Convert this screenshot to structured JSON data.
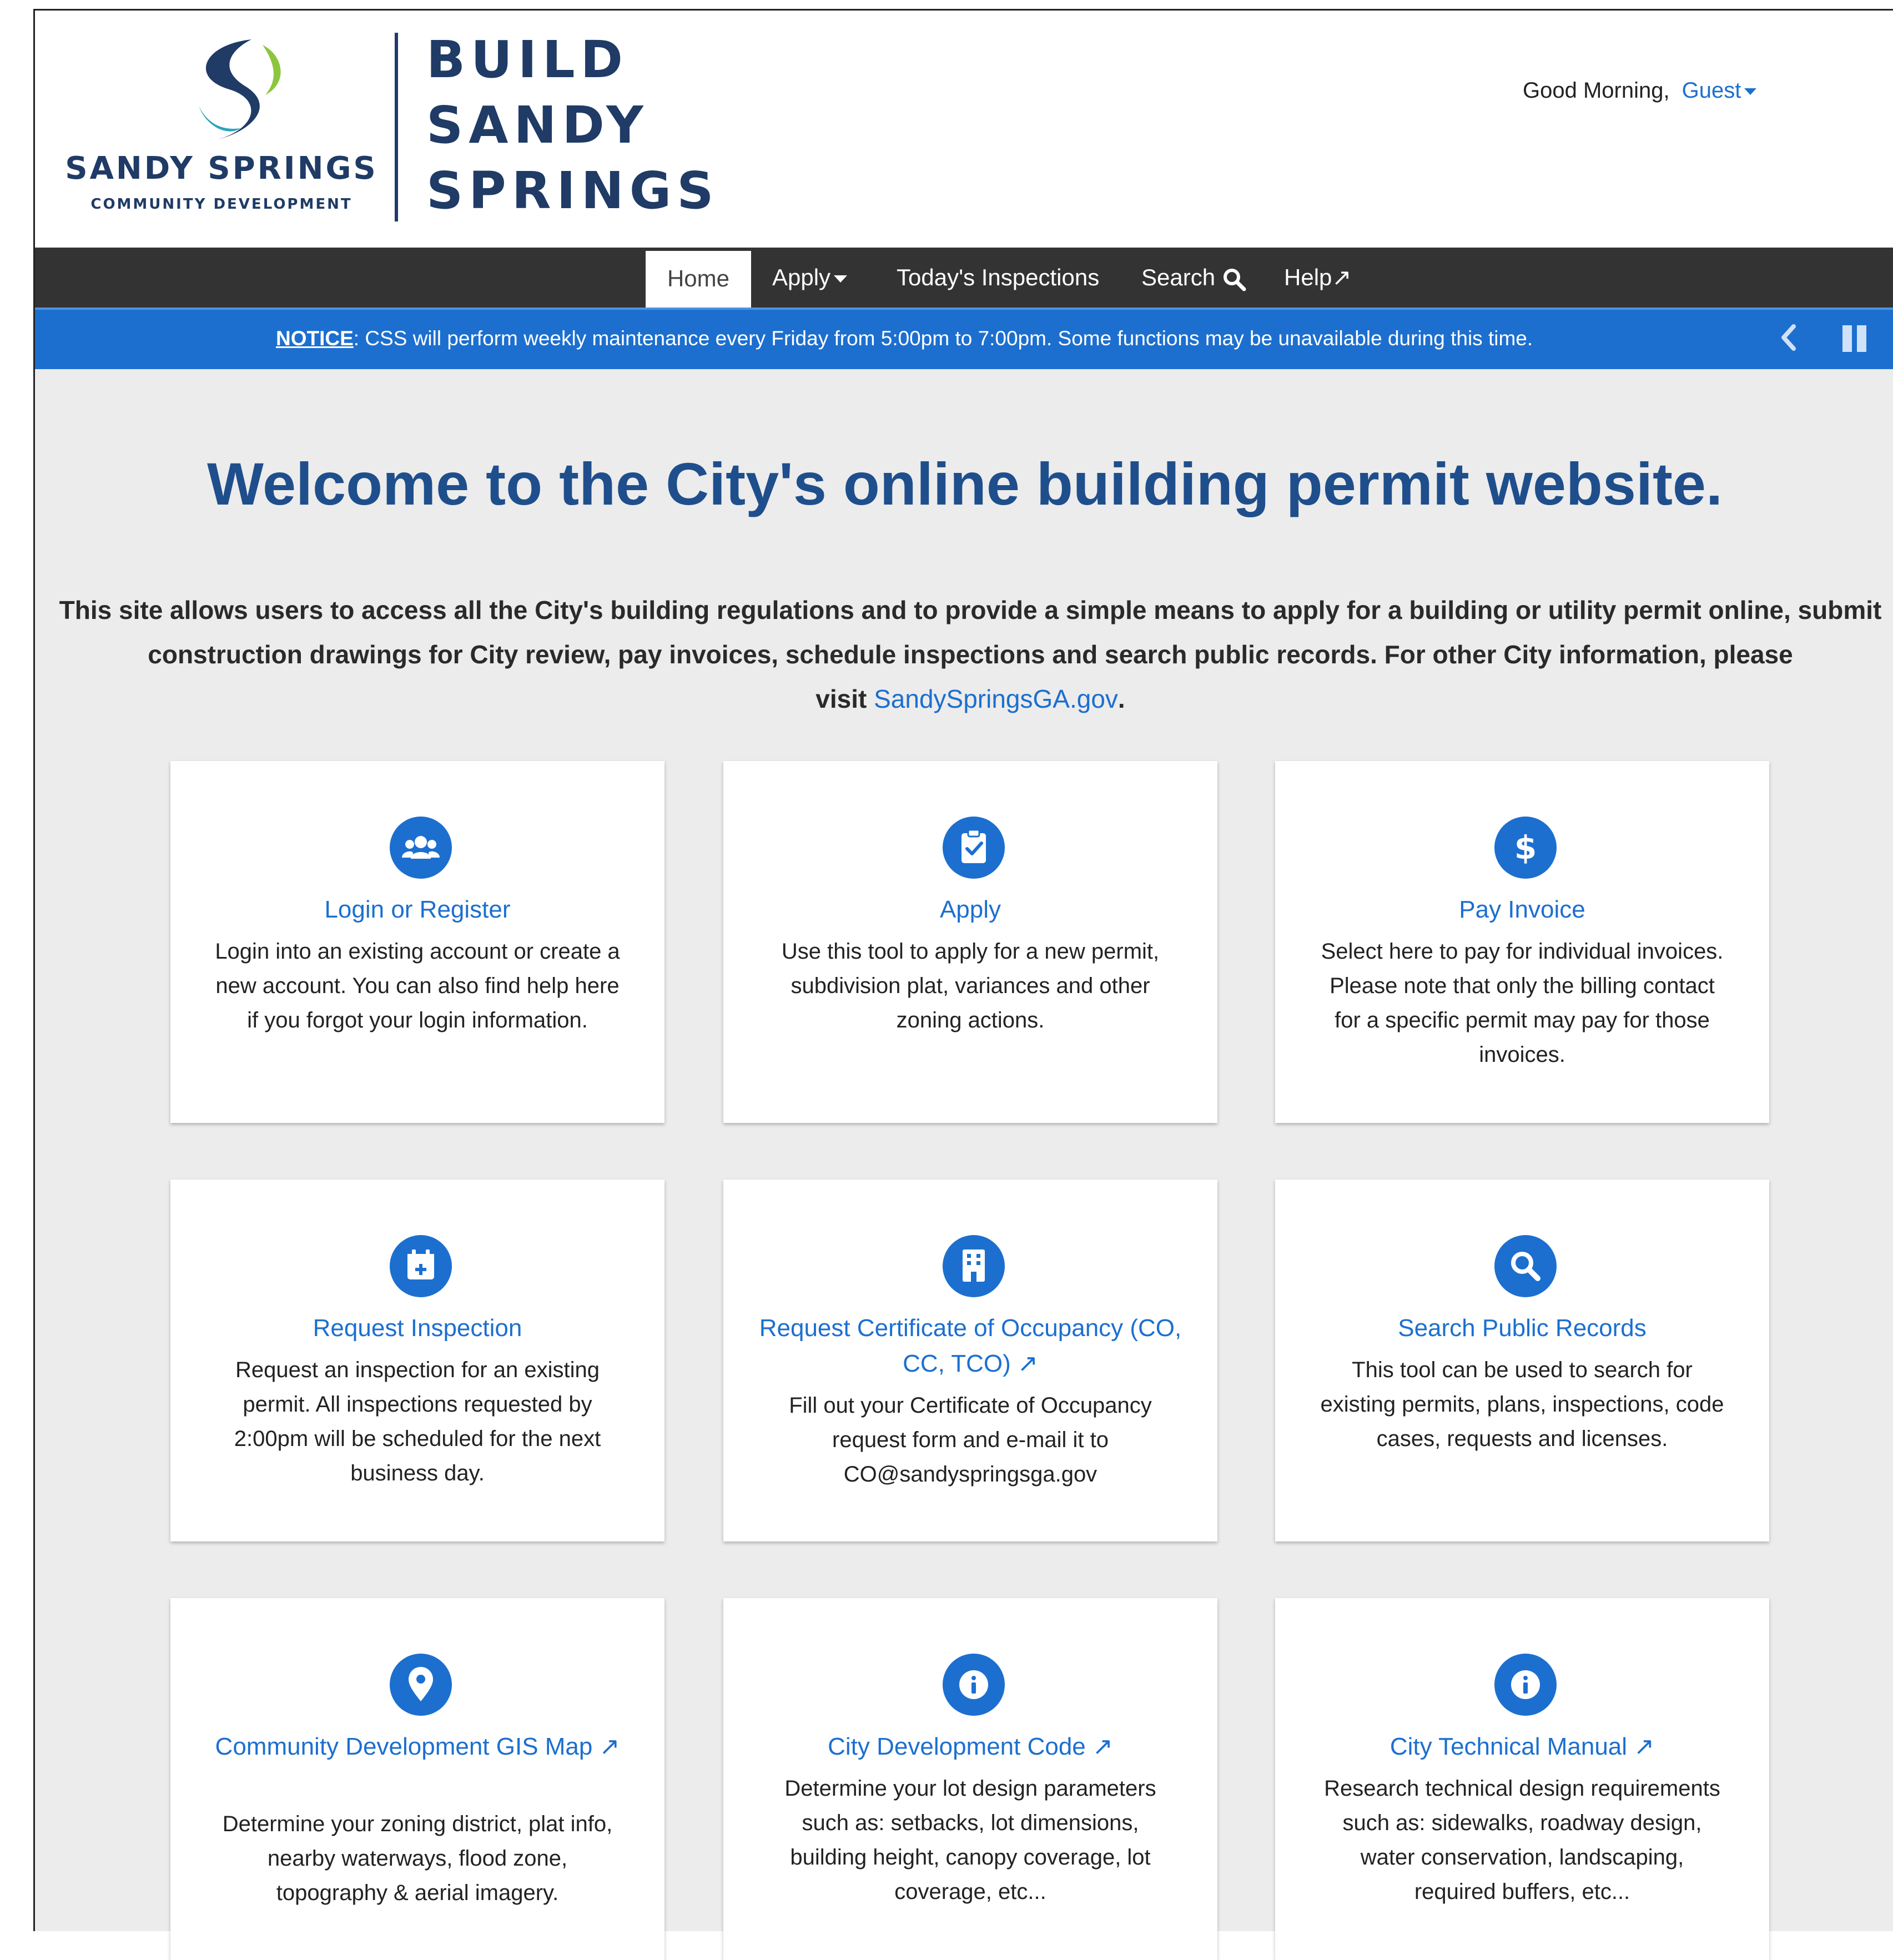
{
  "header": {
    "brand_name": "SANDY SPRINGS",
    "brand_sub": "COMMUNITY DEVELOPMENT",
    "title_line1": "BUILD",
    "title_line2": "SANDY",
    "title_line3": "SPRINGS",
    "greeting": "Good Morning,",
    "user": "Guest"
  },
  "nav": {
    "home": "Home",
    "apply": "Apply",
    "inspections": "Today's Inspections",
    "search": "Search",
    "help": "Help↗"
  },
  "notice": {
    "label": "NOTICE",
    "text": ": CSS will perform weekly maintenance every Friday from 5:00pm to 7:00pm.  Some functions may be unavailable during this time."
  },
  "main": {
    "title": "Welcome to the City's online building permit website.",
    "intro_line1": "This site allows users to access all the City's building regulations and to provide a simple means to apply for a building or utility permit online, submit",
    "intro_line2": "construction drawings for City review, pay invoices, schedule inspections and search public records. For other City information, please",
    "intro_visit": "visit ",
    "intro_link": "SandySpringsGA.gov",
    "intro_end": "."
  },
  "cards": [
    {
      "icon": "users-icon",
      "title": "Login or Register",
      "desc": "Login into an existing account or create a new account. You can also find help here if you forgot your login information."
    },
    {
      "icon": "clipboard-check-icon",
      "title": "Apply",
      "desc": "Use this tool to apply for a new permit, subdivision plat, variances and other zoning actions."
    },
    {
      "icon": "dollar-icon",
      "title": "Pay Invoice",
      "desc": "Select here to pay for individual invoices. Please note that only the billing contact for a specific permit may pay for those invoices."
    },
    {
      "icon": "calendar-plus-icon",
      "title": "Request Inspection",
      "desc": "Request an inspection for an existing permit. All inspections requested by 2:00pm will be scheduled for the next business day."
    },
    {
      "icon": "building-icon",
      "title": "Request Certificate of Occupancy (CO, CC, TCO) ↗",
      "desc": "Fill out your Certificate of Occupancy request form and e-mail it to CO@sandyspringsga.gov"
    },
    {
      "icon": "search-icon",
      "title": "Search Public Records",
      "desc": "This tool can be used to search for existing permits, plans, inspections, code cases, requests and licenses."
    },
    {
      "icon": "map-pin-icon",
      "title": "Community Development GIS Map ↗",
      "desc": "Determine your zoning district, plat info, nearby waterways, flood zone, topography & aerial imagery."
    },
    {
      "icon": "info-icon",
      "title": "City Development Code ↗",
      "desc": "Determine your lot design parameters such as: setbacks, lot dimensions, building height, canopy coverage, lot coverage, etc..."
    },
    {
      "icon": "info-icon",
      "title": "City Technical Manual ↗",
      "desc": "Research technical design requirements such as: sidewalks, roadway design, water conservation, landscaping, required buffers, etc..."
    }
  ],
  "colors": {
    "brand_navy": "#1f3b66",
    "accent_blue": "#1c6fcf",
    "nav_bg": "#333333",
    "page_bg": "#ececec"
  }
}
